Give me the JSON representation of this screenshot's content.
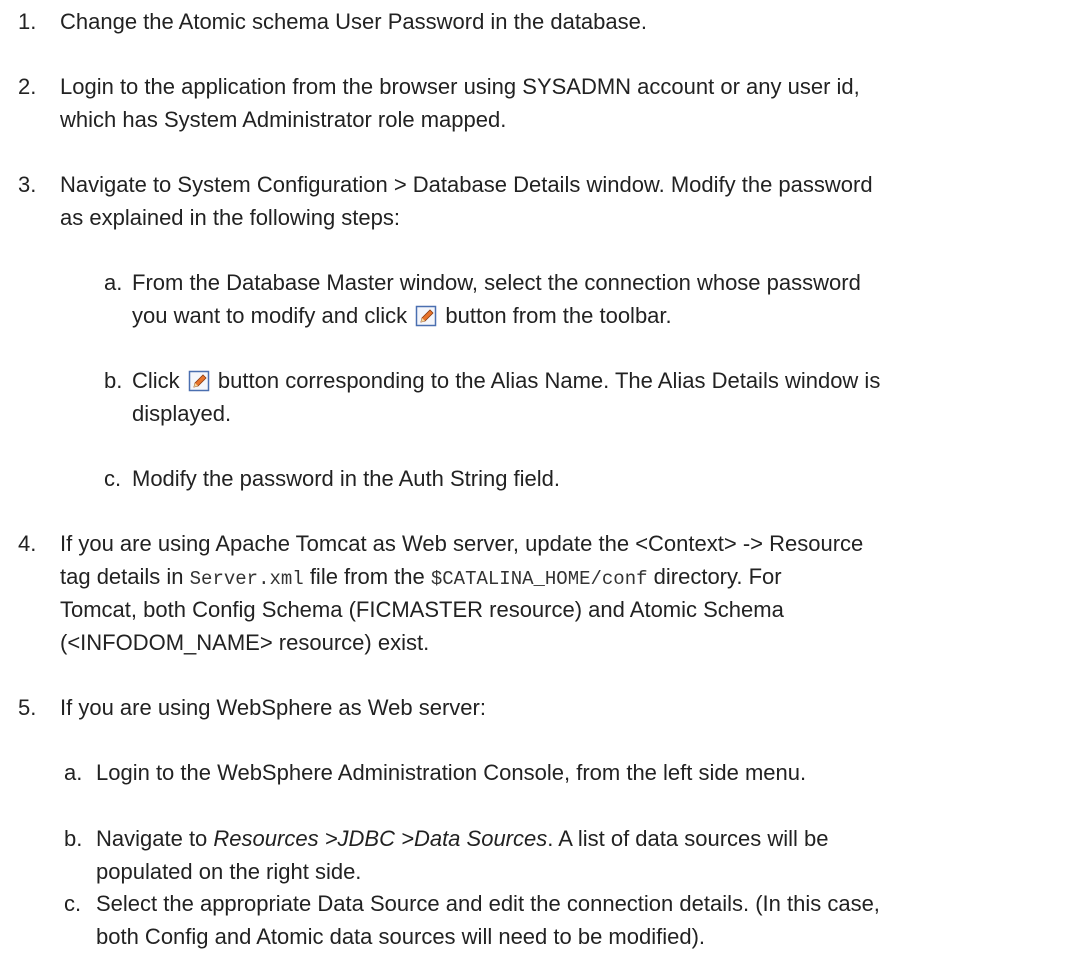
{
  "steps": [
    {
      "num": "1.",
      "text": "Change the Atomic schema User Password in the database."
    },
    {
      "num": "2.",
      "line1": "Login to the application from the browser using SYSADMN account or any user id,",
      "line2": "which has System Administrator role mapped."
    },
    {
      "num": "3.",
      "line1": "Navigate to System Configuration > Database Details window. Modify the password",
      "line2": "as explained in the following steps:",
      "sub": [
        {
          "num": "a.",
          "line1": "From the Database Master window, select the connection whose password",
          "line2a": "you want to modify and click",
          "line2b": "button from the toolbar.",
          "icon": "edit-icon"
        },
        {
          "num": "b.",
          "line1a": "Click",
          "line1b": "button corresponding to the Alias Name. The Alias Details window is",
          "line2": "displayed.",
          "icon": "edit-icon"
        },
        {
          "num": "c.",
          "text": "Modify the password in the Auth String field."
        }
      ]
    },
    {
      "num": "4.",
      "line1": "If you are using Apache Tomcat as Web server, update the <Context> -> Resource",
      "line2a": "tag details in",
      "line2_code1": "Server.xml",
      "line2b": "file from the",
      "line2_code2": "$CATALINA_HOME/conf",
      "line2c": "directory. For",
      "line3": "Tomcat, both Config Schema (FICMASTER resource) and Atomic Schema",
      "line4": "(<INFODOM_NAME> resource) exist."
    },
    {
      "num": "5.",
      "text": "If you are using WebSphere as Web server:",
      "sub": [
        {
          "num": "a.",
          "text": "Login to the WebSphere Administration Console, from the left side menu."
        },
        {
          "num": "b.",
          "line1a": "Navigate to",
          "line1_italic": "Resources >JDBC >Data Sources",
          "line1b": ". A list of data sources will be",
          "line2": "populated on the right side."
        },
        {
          "num": "c.",
          "line1": "Select the appropriate Data Source and edit the connection details. (In this case,",
          "line2": "both Config and Atomic data sources will need to be modified)."
        }
      ]
    }
  ]
}
